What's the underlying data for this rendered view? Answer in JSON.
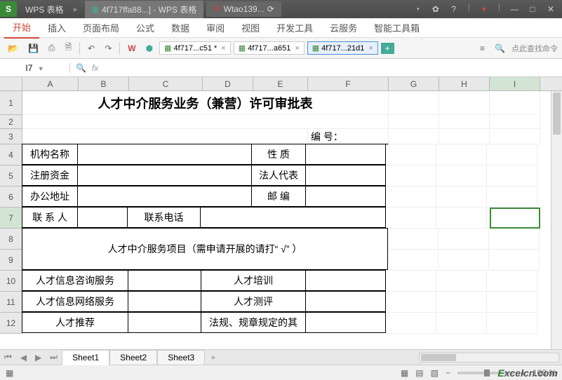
{
  "titlebar": {
    "logo": "S",
    "app_name": "WPS 表格",
    "doc1": "4f717ffa88...] - WPS 表格",
    "doc2": "Wtao139..."
  },
  "menu": {
    "items": [
      "开始",
      "插入",
      "页面布局",
      "公式",
      "数据",
      "审阅",
      "视图",
      "开发工具",
      "云服务",
      "智能工具箱"
    ]
  },
  "toolbar": {
    "file_tabs": [
      "4f717...c51 *",
      "4f717...a651",
      "4f717...21d1"
    ],
    "search_hint": "点此查找命令"
  },
  "formula": {
    "cell_ref": "I7",
    "fx_label": "fx"
  },
  "columns": [
    "A",
    "B",
    "C",
    "D",
    "E",
    "F",
    "G",
    "H",
    "I"
  ],
  "rows": [
    "1",
    "2",
    "3",
    "4",
    "5",
    "6",
    "7",
    "8",
    "9",
    "10",
    "11",
    "12"
  ],
  "cells": {
    "title": "人才中介服务业务（兼营）许可审批表",
    "r3_label": "编    号：",
    "r4a": "机构名称",
    "r4e": "性    质",
    "r5a": "注册资金",
    "r5e": "法人代表",
    "r6a": "办公地址",
    "r6e": "邮    编",
    "r7a": "联 系 人",
    "r7c": "联系电话",
    "r8_merge": "人才中介服务项目（需申请开展的请打“ √”      ）",
    "r10a": "人才信息咨询服务",
    "r10d": "人才培训",
    "r11a": "人才信息网络服务",
    "r11d": "人才测评",
    "r12a": "人才推荐",
    "r12d": "法规、规章规定的其"
  },
  "sheets": {
    "tabs": [
      "Sheet1",
      "Sheet2",
      "Sheet3"
    ]
  },
  "status": {
    "zoom": "100 %"
  },
  "watermark": {
    "e": "E",
    "rest": "xcelcn.com"
  }
}
